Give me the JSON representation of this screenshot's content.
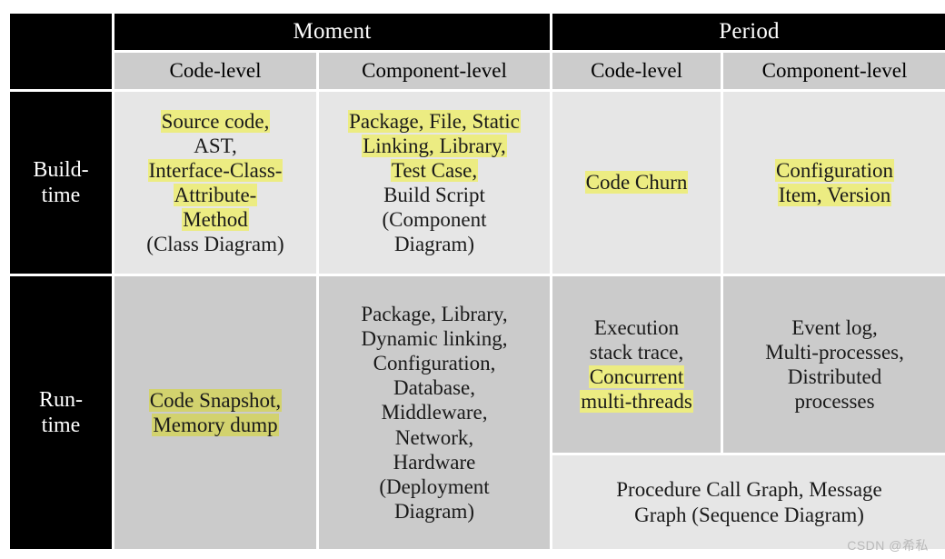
{
  "table": {
    "corner_label": "",
    "top_headers": [
      {
        "label": "Moment",
        "span": 2
      },
      {
        "label": "Period",
        "span": 2
      }
    ],
    "sub_headers": [
      "Code-level",
      "Component-level",
      "Code-level",
      "Component-level"
    ],
    "rows": [
      {
        "stub": "Build-\ntime",
        "stub_line1": "Build-",
        "stub_line2": "time",
        "cells": {
          "moment_code": {
            "lines": [
              {
                "text": "Source code,",
                "highlight": true
              },
              {
                "text": "AST,",
                "highlight": false
              },
              {
                "text": "Interface-Class-",
                "highlight": true
              },
              {
                "text": "Attribute-",
                "highlight": true
              },
              {
                "text": "Method",
                "highlight": true
              },
              {
                "text": "(Class Diagram)",
                "highlight": false
              }
            ]
          },
          "moment_component": {
            "lines": [
              {
                "text": "Package, File, Static",
                "highlight": true
              },
              {
                "text": "Linking, Library,",
                "highlight": true
              },
              {
                "text": "Test Case,",
                "highlight": true
              },
              {
                "text": "Build Script",
                "highlight": false
              },
              {
                "text": "(Component",
                "highlight": false
              },
              {
                "text": "Diagram)",
                "highlight": false
              }
            ]
          },
          "period_code": {
            "lines": [
              {
                "text": "Code Churn",
                "highlight": true
              }
            ]
          },
          "period_component": {
            "lines": [
              {
                "text": "Configuration",
                "highlight": true
              },
              {
                "text": "Item, Version",
                "highlight": true
              }
            ]
          }
        }
      },
      {
        "stub": "Run-\ntime",
        "stub_line1": "Run-",
        "stub_line2": "time",
        "cells": {
          "moment_code": {
            "lines": [
              {
                "text": "Code Snapshot,",
                "highlight": true
              },
              {
                "text": "Memory dump",
                "highlight": true
              }
            ]
          },
          "moment_component": {
            "lines": [
              {
                "text": "Package, Library,",
                "highlight": false
              },
              {
                "text": "Dynamic  linking,",
                "highlight": false
              },
              {
                "text": "Configuration,",
                "highlight": false
              },
              {
                "text": "Database,",
                "highlight": false
              },
              {
                "text": "Middleware,",
                "highlight": false
              },
              {
                "text": "Network,",
                "highlight": false
              },
              {
                "text": "Hardware",
                "highlight": false
              },
              {
                "text": "(Deployment",
                "highlight": false
              },
              {
                "text": "Diagram)",
                "highlight": false
              }
            ]
          },
          "period_code": {
            "lines": [
              {
                "text": "Execution",
                "highlight": false
              },
              {
                "text": "stack trace,",
                "highlight": false
              },
              {
                "text": "Concurrent",
                "highlight": true
              },
              {
                "text": "multi-threads",
                "highlight": true
              }
            ]
          },
          "period_component": {
            "lines": [
              {
                "text": "Event log,",
                "highlight": false
              },
              {
                "text": "Multi-processes,",
                "highlight": false
              },
              {
                "text": "Distributed",
                "highlight": false
              },
              {
                "text": "processes",
                "highlight": false
              }
            ]
          },
          "period_merged_bottom": {
            "lines": [
              {
                "text": "Procedure Call Graph, Message",
                "highlight": false
              },
              {
                "text": "Graph (Sequence Diagram)",
                "highlight": false
              }
            ]
          }
        }
      }
    ]
  },
  "watermark": "CSDN @希私",
  "colors": {
    "header_black": "#000000",
    "header_gray": "#cccccc",
    "cell_light": "#e6e6e6",
    "cell_mid": "#cbcbcb",
    "highlight_yellow": "#ecec82",
    "highlight_olive": "#d2d26e",
    "text": "#1a1a1a",
    "header_text": "#ffffff"
  }
}
